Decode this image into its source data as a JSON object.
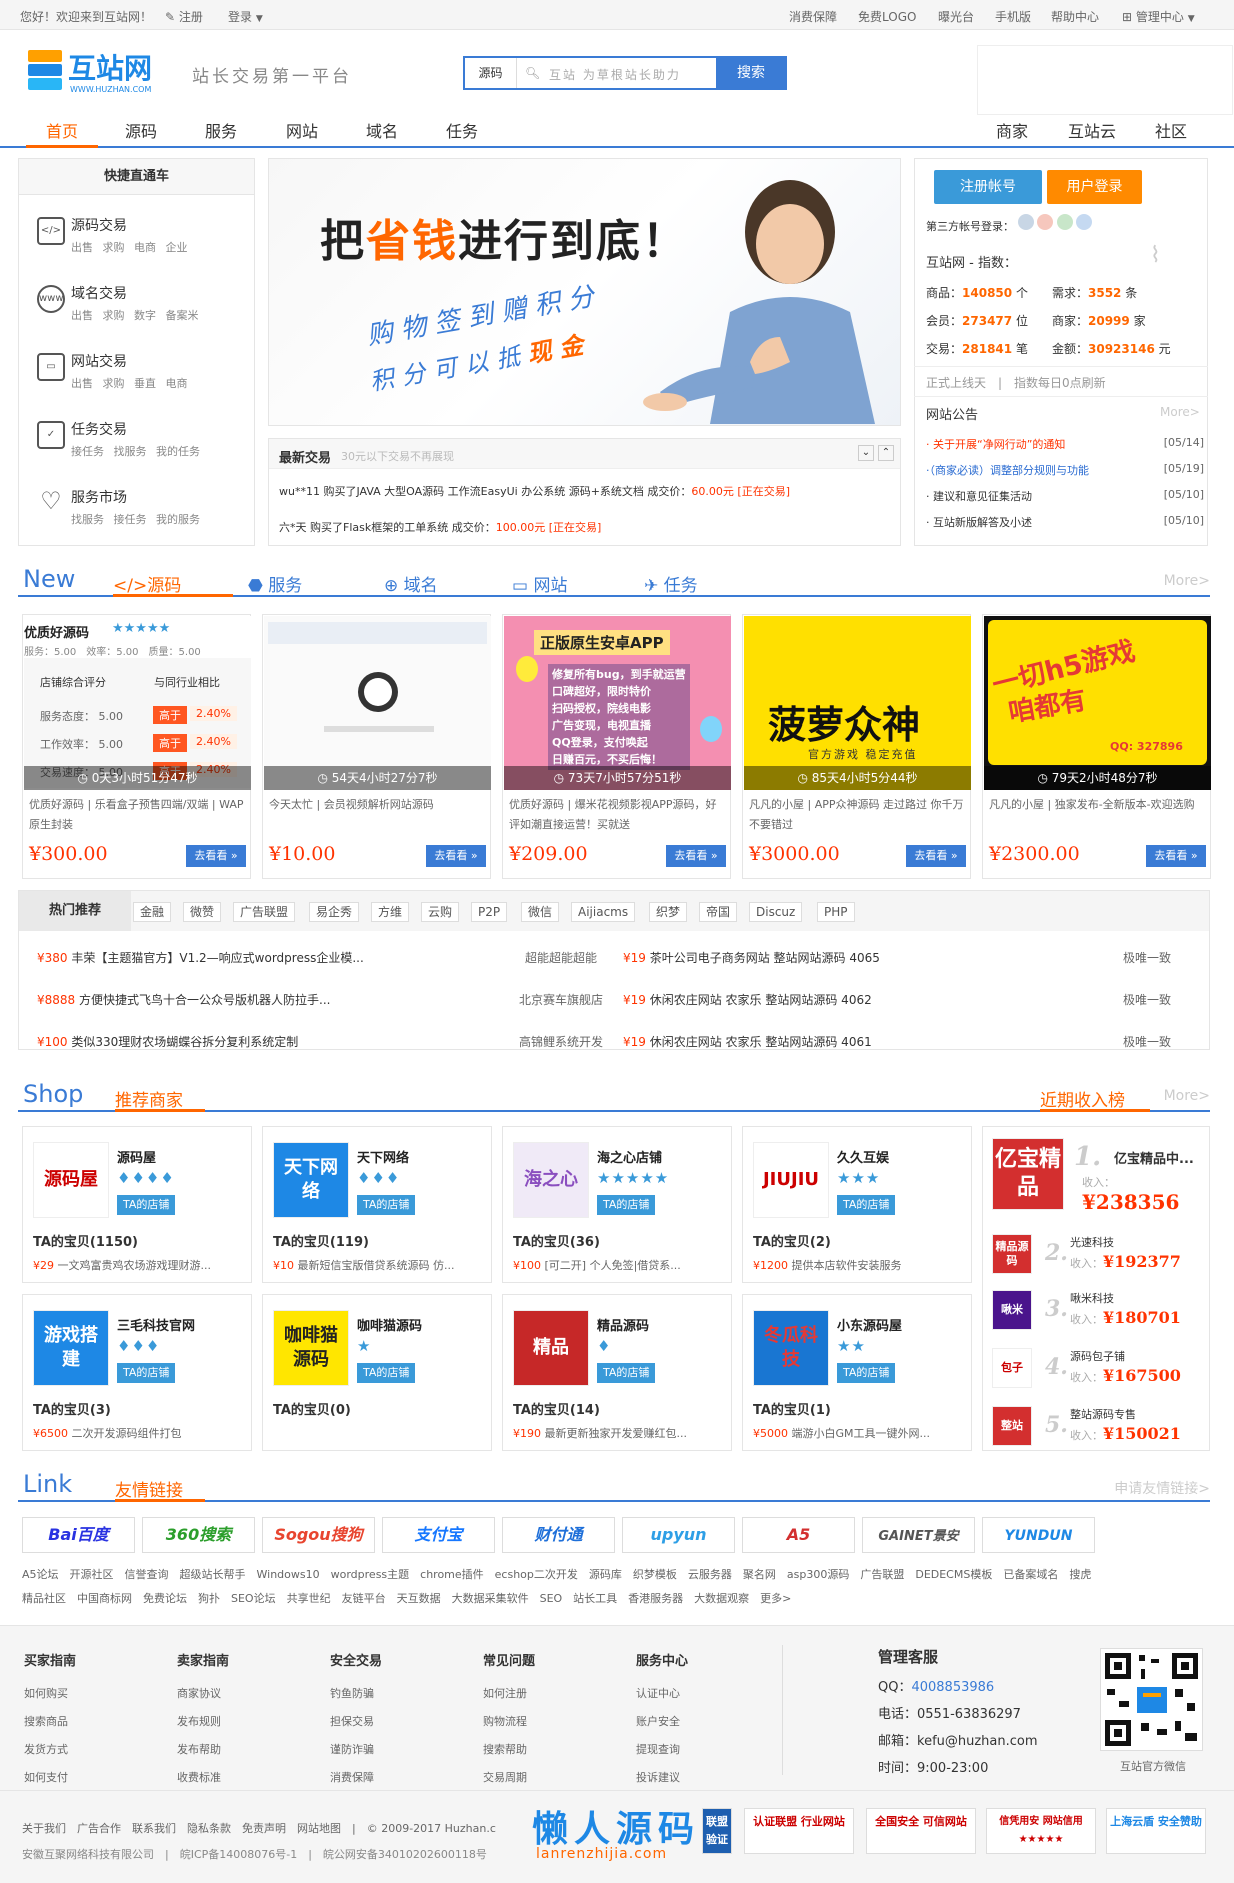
{
  "topbar": {
    "welcome": "您好！欢迎来到互站网！",
    "register": "注册",
    "login": "登录",
    "links": [
      "消费保障",
      "免费LOGO",
      "曝光台",
      "手机版",
      "帮助中心",
      "管理中心"
    ]
  },
  "header": {
    "logo_text": "互站网",
    "logo_url": "WWW.HUZHAN.COM",
    "slogan": "站长交易第一平台",
    "search_cat": "源码",
    "search_placeholder": "互站 为草根站长助力",
    "search_btn": "搜索"
  },
  "nav": {
    "left": [
      "首页",
      "源码",
      "服务",
      "网站",
      "域名",
      "任务"
    ],
    "right": [
      "商家",
      "互站云",
      "社区"
    ]
  },
  "quick": {
    "title": "快捷直通车",
    "items": [
      {
        "title": "源码交易",
        "sub": "出售 求购 电商 企业",
        "icon": "</>"
      },
      {
        "title": "域名交易",
        "sub": "出售 求购 数字 备案米",
        "icon": "www"
      },
      {
        "title": "网站交易",
        "sub": "出售 求购 垂直 电商",
        "icon": "▭"
      },
      {
        "title": "任务交易",
        "sub": "接任务 找服务 我的任务",
        "icon": "✓"
      },
      {
        "title": "服务市场",
        "sub": "找服务 接任务 我的服务",
        "icon": "♡"
      }
    ]
  },
  "banner": {
    "title_pre": "把",
    "title_hl": "省钱",
    "title_post": "进行到底！",
    "line1": "购物签到赠积分",
    "line2_pre": "积分可以抵",
    "line2_hl": "现金"
  },
  "trades": {
    "title": "最新交易",
    "note": "30元以下交易不再展现",
    "rows": [
      {
        "text": "wu**11 购买了JAVA 大型OA源码 工作流EasyUi 办公系统 源码+系统文档 成交价：",
        "price": "60.00元 [正在交易]"
      },
      {
        "text": "六*天 购买了Flask框架的工单系统 成交价：",
        "price": "100.00元 [正在交易]"
      }
    ]
  },
  "account": {
    "reg": "注册帐号",
    "login": "用户登录",
    "third": "第三方帐号登录：",
    "index_title": "互站网 - 指数：",
    "stats": [
      [
        "商品：",
        "140850",
        "个",
        "需求：",
        "3552",
        "条"
      ],
      [
        "会员：",
        "273477",
        "位",
        "商家：",
        "20999",
        "家"
      ],
      [
        "交易：",
        "281841",
        "笔",
        "金额：",
        "30923146",
        "元"
      ]
    ],
    "status": "正式上线天　|　指数每日0点刷新",
    "notice_title": "网站公告",
    "more": "More>",
    "notices": [
      {
        "t": "· 关于开展“净网行动”的通知",
        "d": "[05/14]"
      },
      {
        "t": "·（商家必读）调整部分规则与功能",
        "d": "[05/19]"
      },
      {
        "t": "· 建议和意见征集活动",
        "d": "[05/10]"
      },
      {
        "t": "· 互站新版解答及小述",
        "d": "[05/10]"
      }
    ]
  },
  "new_section": {
    "big": "New",
    "tabs": [
      "</>源码",
      "服务",
      "域名",
      "网站",
      "任务"
    ],
    "more": "More>"
  },
  "cards": [
    {
      "timer": "0天3小时51分47秒",
      "desc": "优质好源码 | 乐看盒子预售四端/双端 | WAP原生封装",
      "price": "¥300.00",
      "go": "去看看 »"
    },
    {
      "timer": "54天4小时27分7秒",
      "desc": "今天太忙 | 会员视频解析网站源码",
      "price": "¥10.00",
      "go": "去看看 »"
    },
    {
      "timer": "73天7小时57分51秒",
      "desc": "优质好源码 | 爆米花视频影视APP源码，好评如潮直接运营！买就送",
      "price": "¥209.00",
      "go": "去看看 »"
    },
    {
      "timer": "85天4小时5分44秒",
      "desc": "凡凡的小屋 | APP众神源码 走过路过 你千万不要错过",
      "price": "¥3000.00",
      "go": "去看看 »"
    },
    {
      "timer": "79天2小时48分7秒",
      "desc": "凡凡的小屋 | 独家发布-全新版本-欢迎选购",
      "price": "¥2300.00",
      "go": "去看看 »"
    }
  ],
  "card1": {
    "title": "优质好源码",
    "stars": "★★★★★",
    "scores": "服务：5.00　效率：5.00　质量：5.00",
    "h1": "店铺综合评分",
    "h2": "与同行业相比",
    "rows": [
      [
        "服务态度：",
        "5.00",
        "高于",
        "2.40%"
      ],
      [
        "工作效率：",
        "5.00",
        "高于",
        "2.40%"
      ],
      [
        "交易速度：",
        "5.00",
        "高于",
        "2.40%"
      ]
    ]
  },
  "card3": {
    "t1": "正版原生安卓APP",
    "lines": [
      "修复所有bug，到手就运营",
      "口碑超好，限时特价",
      "扫码授权，院线电影",
      "广告变现，电视直播",
      "QQ登录，支付唤起",
      "日赚百元，不买后悔！"
    ]
  },
  "card4": {
    "t1": "菠萝众神",
    "t2": "官方游戏 稳定充值"
  },
  "card5": {
    "t1": "一切h5游戏",
    "t2": "咱都有",
    "qq": "QQ: 327896"
  },
  "hot": {
    "title": "热门推荐",
    "tags": [
      "金融",
      "微赞",
      "广告联盟",
      "易企秀",
      "方维",
      "云购",
      "P2P",
      "微信",
      "Aijiacms",
      "织梦",
      "帝国",
      "Discuz",
      "PHP"
    ],
    "rows": [
      {
        "p": "¥380",
        "t": "丰荣【主题猫官方】V1.2—响应式wordpress企业模...",
        "a": "超能超能超能"
      },
      {
        "p": "¥19",
        "t": "茶叶公司电子商务网站 整站网站源码 4065",
        "a": "极唯一致"
      },
      {
        "p": "¥8888",
        "t": "方便快捷式飞鸟十合一公众号版机器人防拉手...",
        "a": "北京赛车旗舰店"
      },
      {
        "p": "¥19",
        "t": "休闲农庄网站 农家乐 整站网站源码 4062",
        "a": "极唯一致"
      },
      {
        "p": "¥100",
        "t": "类似330理财农场蝴蝶谷拆分复利系统定制",
        "a": "高锦鲤系统开发"
      },
      {
        "p": "¥19",
        "t": "休闲农庄网站 农家乐 整站网站源码 4061",
        "a": "极唯一致"
      }
    ]
  },
  "shop_section": {
    "big": "Shop",
    "tab": "推荐商家",
    "rank": "近期收入榜",
    "more": "More>"
  },
  "shops": [
    {
      "name": "源码屋",
      "dia": "♦♦♦♦",
      "badge": "TA的店铺",
      "cnt": "TA的宝贝(1150)",
      "p": "¥29",
      "item": "一文鸡富贵鸡农场游戏理财游...",
      "logo": "源码屋",
      "logo_bg": "#fff",
      "logo_c": "#c00"
    },
    {
      "name": "天下网络",
      "dia": "♦♦♦",
      "badge": "TA的店铺",
      "cnt": "TA的宝贝(119)",
      "p": "¥10",
      "item": "最新短信宝版借贷系统源码 仿...",
      "logo": "天下网络",
      "logo_bg": "#1e88e5",
      "logo_c": "#fff"
    },
    {
      "name": "海之心店铺",
      "dia": "★★★★★",
      "badge": "TA的店铺",
      "cnt": "TA的宝贝(36)",
      "p": "¥100",
      "item": "[可二开] 个人免签|借贷系...",
      "logo": "海之心",
      "logo_bg": "#f0eaf7",
      "logo_c": "#8a4fbf"
    },
    {
      "name": "久久互娱",
      "dia": "★★★",
      "badge": "TA的店铺",
      "cnt": "TA的宝贝(2)",
      "p": "¥1200",
      "item": "提供本店软件安装服务",
      "logo": "JIUJIU",
      "logo_bg": "#fff",
      "logo_c": "#c00"
    },
    {
      "name": "三毛科技官网",
      "dia": "♦♦♦",
      "badge": "TA的店铺",
      "cnt": "TA的宝贝(3)",
      "p": "¥6500",
      "item": "二次开发源码组件打包",
      "logo": "游戏搭建",
      "logo_bg": "#1e88e5",
      "logo_c": "#fff"
    },
    {
      "name": "咖啡猫源码",
      "dia": "★",
      "badge": "TA的店铺",
      "cnt": "TA的宝贝(0)",
      "p": "",
      "item": "",
      "logo": "咖啡猫源码",
      "logo_bg": "#ffe600",
      "logo_c": "#222"
    },
    {
      "name": "精品源码",
      "dia": "♦",
      "badge": "TA的店铺",
      "cnt": "TA的宝贝(14)",
      "p": "¥190",
      "item": "最新更新独家开发爱赚红包...",
      "logo": "精品",
      "logo_bg": "#c62828",
      "logo_c": "#fff"
    },
    {
      "name": "小东源码屋",
      "dia": "★★",
      "badge": "TA的店铺",
      "cnt": "TA的宝贝(1)",
      "p": "¥5000",
      "item": "端游小白GM工具一键外网...",
      "logo": "冬瓜科技",
      "logo_bg": "#1976d2",
      "logo_c": "#e53935"
    }
  ],
  "rank": [
    {
      "n": "1.",
      "name": "亿宝精品中...",
      "inc": "¥238356",
      "logo": "亿宝精品",
      "bg": "#d32f2f"
    },
    {
      "n": "2.",
      "name": "光速科技",
      "inc": "¥192377",
      "logo": "精品源码",
      "bg": "#d32f2f"
    },
    {
      "n": "3.",
      "name": "啾米科技",
      "inc": "¥180701",
      "logo": "啾米",
      "bg": "#4a148c"
    },
    {
      "n": "4.",
      "name": "源码包子铺",
      "inc": "¥167500",
      "logo": "包子",
      "bg": "#fff"
    },
    {
      "n": "5.",
      "name": "整站源码专售",
      "inc": "¥150021",
      "logo": "整站",
      "bg": "#d32f2f"
    }
  ],
  "rank_income_label": "收入：",
  "link_section": {
    "big": "Link",
    "tab": "友情链接",
    "apply": "申请友情链接>"
  },
  "link_logos": [
    {
      "t": "Bai百度",
      "c": "#2932e1"
    },
    {
      "t": "360搜索",
      "c": "#2b9e2b"
    },
    {
      "t": "Sogou搜狗",
      "c": "#e8452f"
    },
    {
      "t": "支付宝",
      "c": "#1677ff"
    },
    {
      "t": "财付通",
      "c": "#1e6fd9"
    },
    {
      "t": "upyun",
      "c": "#2e9fe6"
    },
    {
      "t": "A5",
      "c": "#d32f2f"
    },
    {
      "t": "GAINET景安",
      "c": "#555"
    },
    {
      "t": "YUNDUN",
      "c": "#1e88e5"
    }
  ],
  "friend_links1": "A5论坛　开源社区　信誉查询　超级站长帮手　Windows10　wordpress主题　chrome插件　ecshop二次开发　源码库　织梦模板　云服务器　聚名网　asp300源码　广告联盟　DEDECMS模板　已备案域名　搜虎",
  "friend_links2": "精品社区　中国商标网　免费论坛　狗扑　SEO论坛　共享世纪　友链平台　天互数据　大数据采集软件　SEO　站长工具　香港服务器　大数据观察　更多>",
  "footer": {
    "cols": [
      {
        "t": "买家指南",
        "items": [
          "如何购买",
          "搜索商品",
          "发货方式",
          "如何支付"
        ]
      },
      {
        "t": "卖家指南",
        "items": [
          "商家协议",
          "发布规则",
          "发布帮助",
          "收费标准"
        ]
      },
      {
        "t": "安全交易",
        "items": [
          "钓鱼防骗",
          "担保交易",
          "谨防诈骗",
          "消费保障"
        ]
      },
      {
        "t": "常见问题",
        "items": [
          "如何注册",
          "购物流程",
          "搜索帮助",
          "交易周期"
        ]
      },
      {
        "t": "服务中心",
        "items": [
          "认证中心",
          "账户安全",
          "提现查询",
          "投诉建议"
        ]
      }
    ],
    "contact_title": "管理客服",
    "qq_label": "QQ：",
    "qq": "4008853986",
    "tel": "电话：0551-63836297",
    "mail": "邮箱：kefu@huzhan.com",
    "time": "时间：9:00-23:00",
    "qr_caption": "互站官方微信",
    "bottom1": "关于我们　广告合作　联系我们　隐私条款　免责声明　网站地图　|　© 2009-2017 Huzhan.c",
    "bottom2": "安徽互聚网络科技有限公司　|　皖ICP备14008076号-1　|　皖公网安备34010202600118号",
    "watermark": "懒人源码",
    "watermark_url": "lanrenzhijia.com",
    "badges": [
      "联盟验证",
      "认证联盟 行业网站",
      "全国安全 可信网站",
      "信凭用安 网站信用 ★★★★★",
      "上海云盾 安全赞助"
    ]
  }
}
